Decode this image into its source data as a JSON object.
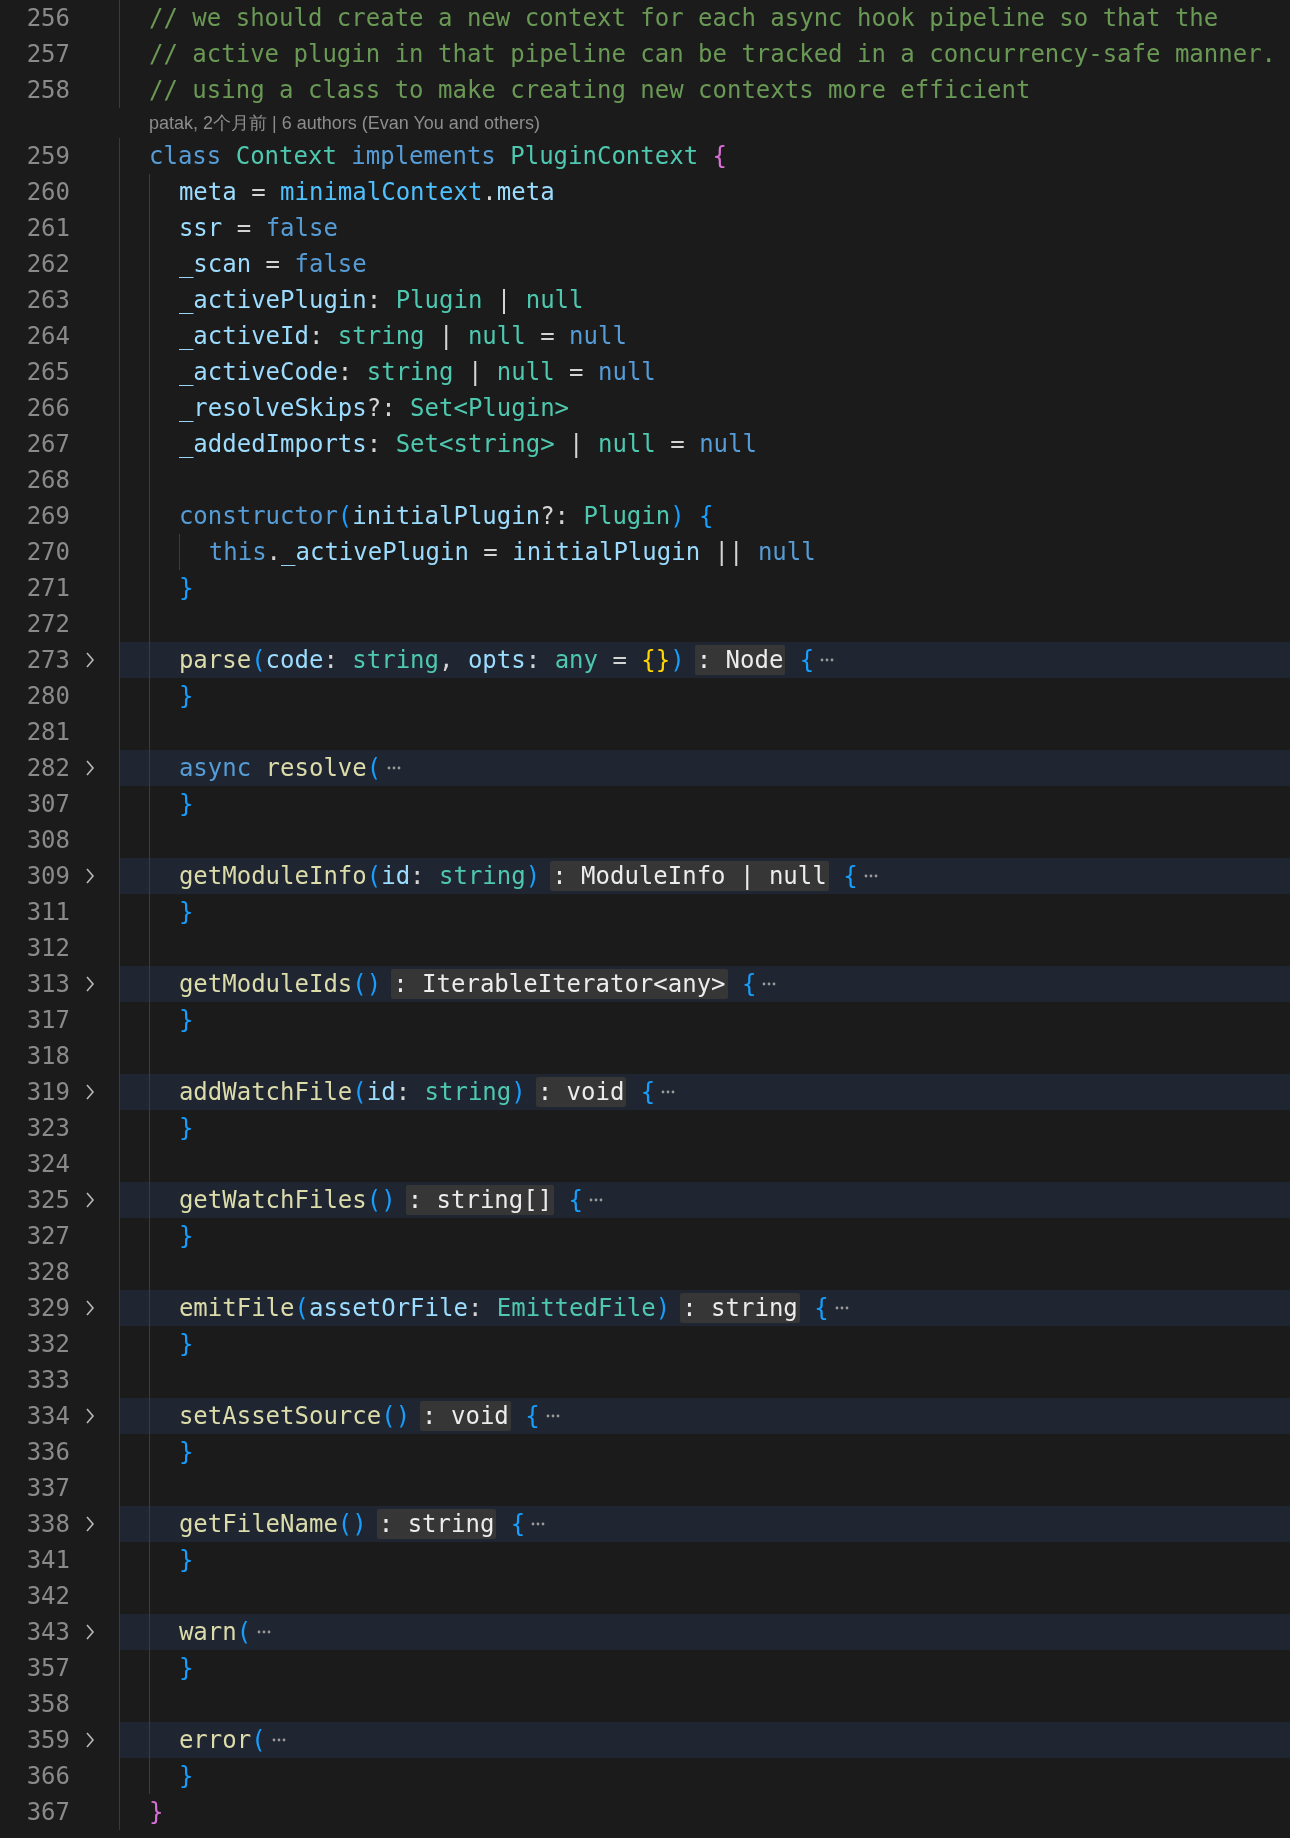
{
  "editor": {
    "rows": [
      {
        "kind": "code",
        "number": "256",
        "folded": false,
        "tokens": [
          {
            "text": "// we should create a new context for each async hook pipeline so that the",
            "kind": "comment"
          }
        ]
      },
      {
        "kind": "code",
        "number": "257",
        "folded": false,
        "tokens": [
          {
            "text": "// active plugin in that pipeline can be tracked in a concurrency-safe manner.",
            "kind": "comment"
          }
        ]
      },
      {
        "kind": "code",
        "number": "258",
        "folded": false,
        "tokens": [
          {
            "text": "// using a class to make creating new contexts more efficient",
            "kind": "comment"
          }
        ]
      },
      {
        "kind": "blame",
        "text": "patak, 2个月前 | 6 authors (Evan You and others)"
      },
      {
        "kind": "code",
        "number": "259",
        "folded": false,
        "tokens": [
          {
            "text": "class",
            "kind": "keyword"
          },
          {
            "text": " Context",
            "kind": "type"
          },
          {
            "text": " implements",
            "kind": "keyword"
          },
          {
            "text": " PluginContext",
            "kind": "type"
          },
          {
            "text": " {",
            "kind": "bracket2"
          }
        ]
      },
      {
        "kind": "code",
        "number": "260",
        "folded": false,
        "indent": "  ",
        "tokens": [
          {
            "text": "meta",
            "kind": "variable"
          },
          {
            "text": " = ",
            "kind": "plain"
          },
          {
            "text": "minimalContext",
            "kind": "constant"
          },
          {
            "text": ".",
            "kind": "plain"
          },
          {
            "text": "meta",
            "kind": "variable"
          }
        ]
      },
      {
        "kind": "code",
        "number": "261",
        "folded": false,
        "indent": "  ",
        "tokens": [
          {
            "text": "ssr",
            "kind": "variable"
          },
          {
            "text": " = ",
            "kind": "plain"
          },
          {
            "text": "false",
            "kind": "keyword"
          }
        ]
      },
      {
        "kind": "code",
        "number": "262",
        "folded": false,
        "indent": "  ",
        "tokens": [
          {
            "text": "_scan",
            "kind": "variable"
          },
          {
            "text": " = ",
            "kind": "plain"
          },
          {
            "text": "false",
            "kind": "keyword"
          }
        ]
      },
      {
        "kind": "code",
        "number": "263",
        "folded": false,
        "indent": "  ",
        "tokens": [
          {
            "text": "_activePlugin",
            "kind": "variable"
          },
          {
            "text": ": ",
            "kind": "plain"
          },
          {
            "text": "Plugin",
            "kind": "type"
          },
          {
            "text": " | ",
            "kind": "plain"
          },
          {
            "text": "null",
            "kind": "type"
          }
        ]
      },
      {
        "kind": "code",
        "number": "264",
        "folded": false,
        "indent": "  ",
        "tokens": [
          {
            "text": "_activeId",
            "kind": "variable"
          },
          {
            "text": ": ",
            "kind": "plain"
          },
          {
            "text": "string",
            "kind": "type"
          },
          {
            "text": " | ",
            "kind": "plain"
          },
          {
            "text": "null",
            "kind": "type"
          },
          {
            "text": " = ",
            "kind": "plain"
          },
          {
            "text": "null",
            "kind": "keyword"
          }
        ]
      },
      {
        "kind": "code",
        "number": "265",
        "folded": false,
        "indent": "  ",
        "tokens": [
          {
            "text": "_activeCode",
            "kind": "variable"
          },
          {
            "text": ": ",
            "kind": "plain"
          },
          {
            "text": "string",
            "kind": "type"
          },
          {
            "text": " | ",
            "kind": "plain"
          },
          {
            "text": "null",
            "kind": "type"
          },
          {
            "text": " = ",
            "kind": "plain"
          },
          {
            "text": "null",
            "kind": "keyword"
          }
        ]
      },
      {
        "kind": "code",
        "number": "266",
        "folded": false,
        "indent": "  ",
        "tokens": [
          {
            "text": "_resolveSkips",
            "kind": "variable"
          },
          {
            "text": "?: ",
            "kind": "plain"
          },
          {
            "text": "Set<Plugin>",
            "kind": "type"
          }
        ]
      },
      {
        "kind": "code",
        "number": "267",
        "folded": false,
        "indent": "  ",
        "tokens": [
          {
            "text": "_addedImports",
            "kind": "variable"
          },
          {
            "text": ": ",
            "kind": "plain"
          },
          {
            "text": "Set<string>",
            "kind": "type"
          },
          {
            "text": " | ",
            "kind": "plain"
          },
          {
            "text": "null",
            "kind": "type"
          },
          {
            "text": " = ",
            "kind": "plain"
          },
          {
            "text": "null",
            "kind": "keyword"
          }
        ]
      },
      {
        "kind": "code",
        "number": "268",
        "folded": false,
        "indent": "  "
      },
      {
        "kind": "code",
        "number": "269",
        "folded": false,
        "indent": "  ",
        "tokens": [
          {
            "text": "constructor",
            "kind": "keyword"
          },
          {
            "text": "(",
            "kind": "bracket3"
          },
          {
            "text": "initialPlugin",
            "kind": "variable"
          },
          {
            "text": "?: ",
            "kind": "plain"
          },
          {
            "text": "Plugin",
            "kind": "type"
          },
          {
            "text": ") {",
            "kind": "bracket3"
          }
        ]
      },
      {
        "kind": "code",
        "number": "270",
        "folded": false,
        "indent": "    ",
        "tokens": [
          {
            "text": "this",
            "kind": "keyword"
          },
          {
            "text": ".",
            "kind": "plain"
          },
          {
            "text": "_activePlugin",
            "kind": "variable"
          },
          {
            "text": " = ",
            "kind": "plain"
          },
          {
            "text": "initialPlugin",
            "kind": "variable"
          },
          {
            "text": " || ",
            "kind": "plain"
          },
          {
            "text": "null",
            "kind": "keyword"
          }
        ]
      },
      {
        "kind": "code",
        "number": "271",
        "folded": false,
        "indent": "  ",
        "tokens": [
          {
            "text": "}",
            "kind": "bracket3"
          }
        ]
      },
      {
        "kind": "code",
        "number": "272",
        "folded": false,
        "indent": "  "
      },
      {
        "kind": "code",
        "number": "273",
        "folded": true,
        "indent": "  ",
        "tokens": [
          {
            "text": "parse",
            "kind": "function"
          },
          {
            "text": "(",
            "kind": "bracket3"
          },
          {
            "text": "code",
            "kind": "variable"
          },
          {
            "text": ": ",
            "kind": "plain"
          },
          {
            "text": "string",
            "kind": "type"
          },
          {
            "text": ", ",
            "kind": "plain"
          },
          {
            "text": "opts",
            "kind": "variable"
          },
          {
            "text": ": ",
            "kind": "plain"
          },
          {
            "text": "any",
            "kind": "type"
          },
          {
            "text": " = ",
            "kind": "plain"
          },
          {
            "text": "{}",
            "kind": "bracket1"
          },
          {
            "text": ")",
            "kind": "bracket3"
          },
          {
            "text": ": Node",
            "kind": "hint"
          },
          {
            "text": " {",
            "kind": "bracket3"
          }
        ]
      },
      {
        "kind": "code",
        "number": "280",
        "folded": false,
        "indent": "  ",
        "tokens": [
          {
            "text": "}",
            "kind": "bracket3"
          }
        ]
      },
      {
        "kind": "code",
        "number": "281",
        "folded": false,
        "indent": "  "
      },
      {
        "kind": "code",
        "number": "282",
        "folded": true,
        "indent": "  ",
        "tokens": [
          {
            "text": "async",
            "kind": "keyword"
          },
          {
            "text": " resolve",
            "kind": "function"
          },
          {
            "text": "(",
            "kind": "bracket3"
          }
        ]
      },
      {
        "kind": "code",
        "number": "307",
        "folded": false,
        "indent": "  ",
        "tokens": [
          {
            "text": "}",
            "kind": "bracket3"
          }
        ]
      },
      {
        "kind": "code",
        "number": "308",
        "folded": false,
        "indent": "  "
      },
      {
        "kind": "code",
        "number": "309",
        "folded": true,
        "indent": "  ",
        "tokens": [
          {
            "text": "getModuleInfo",
            "kind": "function"
          },
          {
            "text": "(",
            "kind": "bracket3"
          },
          {
            "text": "id",
            "kind": "variable"
          },
          {
            "text": ": ",
            "kind": "plain"
          },
          {
            "text": "string",
            "kind": "type"
          },
          {
            "text": ")",
            "kind": "bracket3"
          },
          {
            "text": ": ModuleInfo | null",
            "kind": "hint"
          },
          {
            "text": " {",
            "kind": "bracket3"
          }
        ]
      },
      {
        "kind": "code",
        "number": "311",
        "folded": false,
        "indent": "  ",
        "tokens": [
          {
            "text": "}",
            "kind": "bracket3"
          }
        ]
      },
      {
        "kind": "code",
        "number": "312",
        "folded": false,
        "indent": "  "
      },
      {
        "kind": "code",
        "number": "313",
        "folded": true,
        "indent": "  ",
        "tokens": [
          {
            "text": "getModuleIds",
            "kind": "function"
          },
          {
            "text": "()",
            "kind": "bracket3"
          },
          {
            "text": ": IterableIterator<any>",
            "kind": "hint"
          },
          {
            "text": " {",
            "kind": "bracket3"
          }
        ]
      },
      {
        "kind": "code",
        "number": "317",
        "folded": false,
        "indent": "  ",
        "tokens": [
          {
            "text": "}",
            "kind": "bracket3"
          }
        ]
      },
      {
        "kind": "code",
        "number": "318",
        "folded": false,
        "indent": "  "
      },
      {
        "kind": "code",
        "number": "319",
        "folded": true,
        "indent": "  ",
        "tokens": [
          {
            "text": "addWatchFile",
            "kind": "function"
          },
          {
            "text": "(",
            "kind": "bracket3"
          },
          {
            "text": "id",
            "kind": "variable"
          },
          {
            "text": ": ",
            "kind": "plain"
          },
          {
            "text": "string",
            "kind": "type"
          },
          {
            "text": ")",
            "kind": "bracket3"
          },
          {
            "text": ": void",
            "kind": "hint"
          },
          {
            "text": " {",
            "kind": "bracket3"
          }
        ]
      },
      {
        "kind": "code",
        "number": "323",
        "folded": false,
        "indent": "  ",
        "tokens": [
          {
            "text": "}",
            "kind": "bracket3"
          }
        ]
      },
      {
        "kind": "code",
        "number": "324",
        "folded": false,
        "indent": "  "
      },
      {
        "kind": "code",
        "number": "325",
        "folded": true,
        "indent": "  ",
        "tokens": [
          {
            "text": "getWatchFiles",
            "kind": "function"
          },
          {
            "text": "()",
            "kind": "bracket3"
          },
          {
            "text": ": string[]",
            "kind": "hint"
          },
          {
            "text": " {",
            "kind": "bracket3"
          }
        ]
      },
      {
        "kind": "code",
        "number": "327",
        "folded": false,
        "indent": "  ",
        "tokens": [
          {
            "text": "}",
            "kind": "bracket3"
          }
        ]
      },
      {
        "kind": "code",
        "number": "328",
        "folded": false,
        "indent": "  "
      },
      {
        "kind": "code",
        "number": "329",
        "folded": true,
        "indent": "  ",
        "tokens": [
          {
            "text": "emitFile",
            "kind": "function"
          },
          {
            "text": "(",
            "kind": "bracket3"
          },
          {
            "text": "assetOrFile",
            "kind": "variable"
          },
          {
            "text": ": ",
            "kind": "plain"
          },
          {
            "text": "EmittedFile",
            "kind": "type"
          },
          {
            "text": ")",
            "kind": "bracket3"
          },
          {
            "text": ": string",
            "kind": "hint"
          },
          {
            "text": " {",
            "kind": "bracket3"
          }
        ]
      },
      {
        "kind": "code",
        "number": "332",
        "folded": false,
        "indent": "  ",
        "tokens": [
          {
            "text": "}",
            "kind": "bracket3"
          }
        ]
      },
      {
        "kind": "code",
        "number": "333",
        "folded": false,
        "indent": "  "
      },
      {
        "kind": "code",
        "number": "334",
        "folded": true,
        "indent": "  ",
        "tokens": [
          {
            "text": "setAssetSource",
            "kind": "function"
          },
          {
            "text": "()",
            "kind": "bracket3"
          },
          {
            "text": ": void",
            "kind": "hint"
          },
          {
            "text": " {",
            "kind": "bracket3"
          }
        ]
      },
      {
        "kind": "code",
        "number": "336",
        "folded": false,
        "indent": "  ",
        "tokens": [
          {
            "text": "}",
            "kind": "bracket3"
          }
        ]
      },
      {
        "kind": "code",
        "number": "337",
        "folded": false,
        "indent": "  "
      },
      {
        "kind": "code",
        "number": "338",
        "folded": true,
        "indent": "  ",
        "tokens": [
          {
            "text": "getFileName",
            "kind": "function"
          },
          {
            "text": "()",
            "kind": "bracket3"
          },
          {
            "text": ": string",
            "kind": "hint"
          },
          {
            "text": " {",
            "kind": "bracket3"
          }
        ]
      },
      {
        "kind": "code",
        "number": "341",
        "folded": false,
        "indent": "  ",
        "tokens": [
          {
            "text": "}",
            "kind": "bracket3"
          }
        ]
      },
      {
        "kind": "code",
        "number": "342",
        "folded": false,
        "indent": "  "
      },
      {
        "kind": "code",
        "number": "343",
        "folded": true,
        "indent": "  ",
        "tokens": [
          {
            "text": "warn",
            "kind": "function"
          },
          {
            "text": "(",
            "kind": "bracket3"
          }
        ]
      },
      {
        "kind": "code",
        "number": "357",
        "folded": false,
        "indent": "  ",
        "tokens": [
          {
            "text": "}",
            "kind": "bracket3"
          }
        ]
      },
      {
        "kind": "code",
        "number": "358",
        "folded": false,
        "indent": "  "
      },
      {
        "kind": "code",
        "number": "359",
        "folded": true,
        "indent": "  ",
        "tokens": [
          {
            "text": "error",
            "kind": "function"
          },
          {
            "text": "(",
            "kind": "bracket3"
          }
        ]
      },
      {
        "kind": "code",
        "number": "366",
        "folded": false,
        "indent": "  ",
        "tokens": [
          {
            "text": "}",
            "kind": "bracket3"
          }
        ]
      },
      {
        "kind": "code",
        "number": "367",
        "folded": false,
        "tokens": [
          {
            "text": "}",
            "kind": "bracket2"
          }
        ]
      }
    ]
  }
}
